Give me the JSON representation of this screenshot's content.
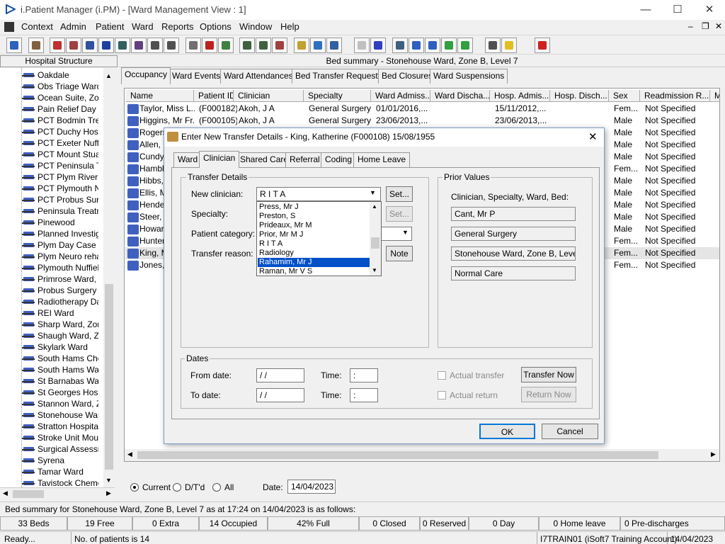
{
  "window": {
    "title": "i.Patient Manager (i.PM) - [Ward Management View : 1]"
  },
  "menu": [
    "Context",
    "Admin",
    "Patient",
    "Ward",
    "Reports",
    "Options",
    "Window",
    "Help"
  ],
  "left_panel": {
    "header": "Hospital Structure",
    "items": [
      "Oakdale",
      "Obs Triage Ward",
      "Ocean Suite, Zor",
      "Pain Relief Day C",
      "PCT Bodmin Trea",
      "PCT Duchy Hosp",
      "PCT Exeter Nuffie",
      "PCT Mount Stuar",
      "PCT Peninsula Tr",
      "PCT Plym River F",
      "PCT Plymouth Nu",
      "PCT Probus Surg",
      "Peninsula Treatm",
      "Pinewood",
      "Planned Investiga",
      "Plym Day Case U",
      "Plym Neuro rehab",
      "Plymouth Nuffield",
      "Primrose Ward, Z",
      "Probus Surgery W",
      "Radiotherapy Day",
      "REI Ward",
      "Sharp Ward, Zon",
      "Shaugh Ward, Zo",
      "Skylark Ward",
      "South Hams Cher",
      "South Hams War",
      "St Barnabas War",
      "St Georges Hosp",
      "Stannon Ward, Z",
      "Stonehouse Ward",
      "Stratton Hospital",
      "Stroke Unit Moun",
      "Surgical Assessm",
      "Syrena",
      "Tamar Ward",
      "Tavistock Chemo"
    ]
  },
  "bed_summary_header": "Bed summary - Stonehouse Ward, Zone B, Level 7",
  "tabs": [
    "Occupancy",
    "Ward Events",
    "Ward Attendances",
    "Bed Transfer Requests",
    "Bed Closures",
    "Ward Suspensions"
  ],
  "table": {
    "columns": [
      "Name",
      "Patient ID",
      "Clinician",
      "Specialty",
      "Ward Admiss...",
      "Ward Discha...",
      "Hosp. Admis...",
      "Hosp. Disch...",
      "Sex",
      "Readmission R...",
      "M"
    ],
    "rows": [
      {
        "name": "Taylor, Miss L...",
        "id": "(F000182)",
        "clinician": "Akoh, J A",
        "specialty": "General Surgery",
        "ward_adm": "01/01/2016,...",
        "hosp_adm": "15/11/2012,...",
        "sex": "Fem...",
        "readm": "Not Specified"
      },
      {
        "name": "Higgins, Mr Fr...",
        "id": "(F000105)",
        "clinician": "Akoh, J A",
        "specialty": "General Surgery",
        "ward_adm": "23/06/2013,...",
        "hosp_adm": "23/06/2013,...",
        "sex": "Male",
        "readm": "Not Specified"
      },
      {
        "name": "Rogers",
        "id": "",
        "clinician": "",
        "specialty": "",
        "ward_adm": "",
        "hosp_adm": "",
        "sex": "Male",
        "readm": "Not Specified"
      },
      {
        "name": "Allen, M",
        "id": "",
        "clinician": "",
        "specialty": "",
        "ward_adm": "",
        "hosp_adm": "",
        "sex": "Male",
        "readm": "Not Specified"
      },
      {
        "name": "Cundy,",
        "id": "",
        "clinician": "",
        "specialty": "",
        "ward_adm": "",
        "hosp_adm": "",
        "sex": "Male",
        "readm": "Not Specified"
      },
      {
        "name": "Hamble",
        "id": "",
        "clinician": "",
        "specialty": "",
        "ward_adm": "",
        "hosp_adm": "",
        "sex": "Fem...",
        "readm": "Not Specified"
      },
      {
        "name": "Hibbs,",
        "id": "",
        "clinician": "",
        "specialty": "",
        "ward_adm": "",
        "hosp_adm": "",
        "sex": "Male",
        "readm": "Not Specified"
      },
      {
        "name": "Ellis, M",
        "id": "",
        "clinician": "",
        "specialty": "",
        "ward_adm": "",
        "hosp_adm": "",
        "sex": "Male",
        "readm": "Not Specified"
      },
      {
        "name": "Hende",
        "id": "",
        "clinician": "",
        "specialty": "",
        "ward_adm": "",
        "hosp_adm": "",
        "sex": "Male",
        "readm": "Not Specified"
      },
      {
        "name": "Steer, M",
        "id": "",
        "clinician": "",
        "specialty": "",
        "ward_adm": "",
        "hosp_adm": "",
        "sex": "Male",
        "readm": "Not Specified"
      },
      {
        "name": "Howard",
        "id": "",
        "clinician": "",
        "specialty": "",
        "ward_adm": "",
        "hosp_adm": "",
        "sex": "Male",
        "readm": "Not Specified"
      },
      {
        "name": "Hunter,",
        "id": "",
        "clinician": "",
        "specialty": "",
        "ward_adm": "",
        "hosp_adm": "",
        "sex": "Fem...",
        "readm": "Not Specified"
      },
      {
        "name": "King, M",
        "id": "",
        "clinician": "",
        "specialty": "",
        "ward_adm": "",
        "hosp_adm": "",
        "sex": "Fem...",
        "readm": "Not Specified"
      },
      {
        "name": "Jones,",
        "id": "",
        "clinician": "",
        "specialty": "",
        "ward_adm": "",
        "hosp_adm": "",
        "sex": "Fem...",
        "readm": "Not Specified"
      }
    ]
  },
  "filter": {
    "current": "Current",
    "dtd": "D/T'd",
    "all": "All",
    "date_label": "Date:",
    "date_value": "14/04/2023"
  },
  "dialog": {
    "title": "Enter New Transfer Details - King, Katherine (F000108) 15/08/1955",
    "tabs": [
      "Ward",
      "Clinician",
      "Shared Care",
      "Referral",
      "Coding",
      "Home Leave"
    ],
    "transfer_details_title": "Transfer Details",
    "new_clinician_label": "New clinician:",
    "new_clinician_value": "R I T A",
    "specialty_label": "Specialty:",
    "patient_category_label": "Patient category:",
    "transfer_reason_label": "Transfer reason:",
    "set_label": "Set...",
    "note_label": "Note",
    "dropdown_items": [
      "Press, Mr J",
      "Preston, S",
      "Prideaux, Mr M",
      "Prior, Mr M J",
      "R I T A",
      "Radiology",
      "Rahamim, Mr J",
      "Raman, Mr V S"
    ],
    "prior_values_title": "Prior Values",
    "prior_label": "Clinician, Specialty, Ward, Bed:",
    "prior_values": [
      "Cant, Mr P",
      "General Surgery",
      "Stonehouse Ward, Zone B, Level 7",
      "Normal Care"
    ],
    "dates_title": "Dates",
    "from_date_label": "From date:",
    "to_date_label": "To date:",
    "time_label": "Time:",
    "date_placeholder": " /  /",
    "time_placeholder": "  :",
    "actual_transfer": "Actual transfer",
    "actual_return": "Actual return",
    "transfer_now": "Transfer Now",
    "return_now": "Return Now",
    "ok": "OK",
    "cancel": "Cancel"
  },
  "status": {
    "summary": "Bed summary for Stonehouse Ward, Zone B, Level 7 as at 17:24 on 14/04/2023 is as follows:",
    "cells": [
      "33 Beds",
      "19 Free",
      "0 Extra",
      "14 Occupied",
      "42% Full",
      "0 Closed",
      "0 Reserved",
      "0 Day",
      "0 Home leave",
      "0 Pre-discharges"
    ],
    "ready": "Ready...",
    "patients": "No. of patients is 14",
    "account": "I7TRAIN01 (iSoft7 Training Account)",
    "date": "14/04/2023"
  },
  "colors": {
    "selection": "#0050c8",
    "accent": "#0078d7"
  }
}
